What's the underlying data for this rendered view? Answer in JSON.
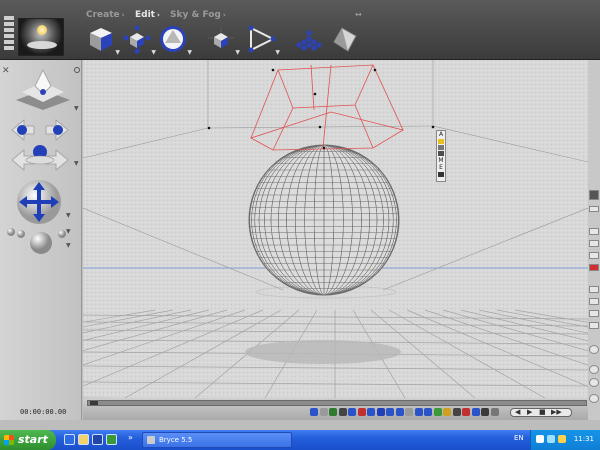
{
  "app": {
    "menu_tabs": [
      {
        "label": "Create",
        "active": false
      },
      {
        "label": "Edit",
        "active": true
      },
      {
        "label": "Sky & Fog",
        "active": false
      }
    ],
    "toolbar_icons": [
      "select-cube-icon",
      "resize-arrows-icon",
      "sphere-rotate-icon",
      "reposition-icon",
      "align-triangle-icon",
      "terrain-grid-icon",
      "material-crystal-icon"
    ],
    "timecode": "00:00:00.00",
    "accent": "#1f3fb8"
  },
  "scene": {
    "object": "sphere",
    "wireframe_color": "#6a6a6a",
    "light_color": "#e05050",
    "horizon_color": "#6a8fd8",
    "selection_labels": [
      "A",
      "M",
      "E"
    ]
  },
  "taskbar": {
    "start_label": "start",
    "task_label": "Bryce 5.5",
    "language": "EN",
    "clock": "11:31"
  }
}
